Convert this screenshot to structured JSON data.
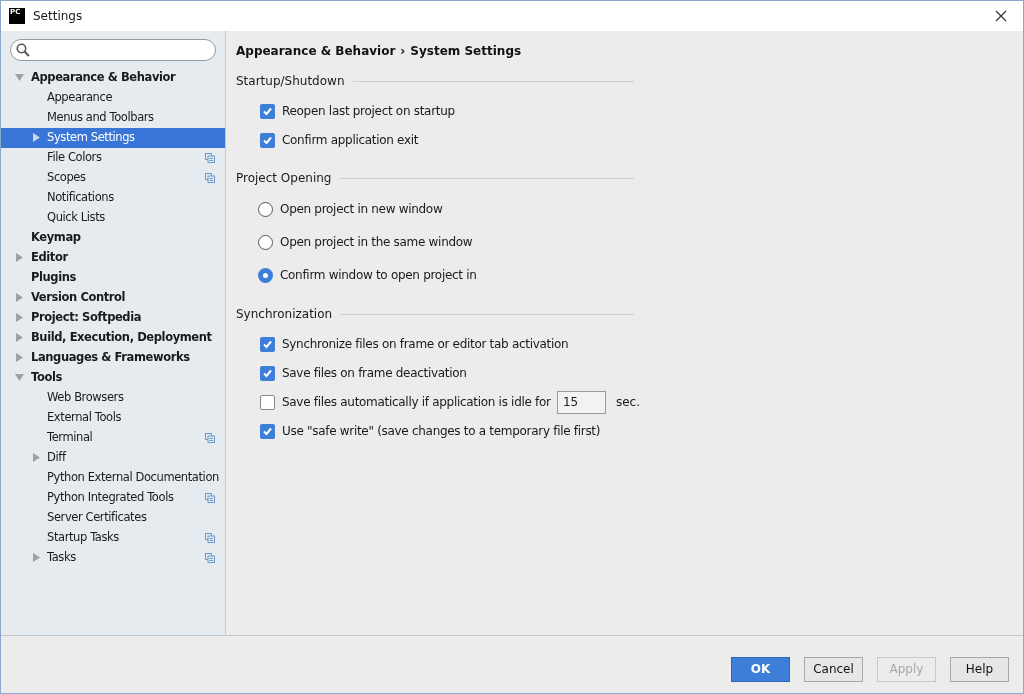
{
  "window": {
    "title": "Settings",
    "app_icon": "PC"
  },
  "tree": [
    {
      "label": "Appearance & Behavior",
      "expanded": true,
      "selected": false,
      "children": [
        {
          "label": "Appearance",
          "selected": false
        },
        {
          "label": "Menus and Toolbars",
          "selected": false
        },
        {
          "label": "System Settings",
          "expanded": false,
          "selected": true
        },
        {
          "label": "File Colors",
          "selected": false,
          "project_level": true
        },
        {
          "label": "Scopes",
          "selected": false,
          "project_level": true
        },
        {
          "label": "Notifications",
          "selected": false
        },
        {
          "label": "Quick Lists",
          "selected": false
        }
      ]
    },
    {
      "label": "Keymap",
      "selected": false
    },
    {
      "label": "Editor",
      "expanded": false,
      "selected": false
    },
    {
      "label": "Plugins",
      "selected": false
    },
    {
      "label": "Version Control",
      "expanded": false,
      "selected": false
    },
    {
      "label": "Project: Softpedia",
      "expanded": false,
      "selected": false
    },
    {
      "label": "Build, Execution, Deployment",
      "expanded": false,
      "selected": false
    },
    {
      "label": "Languages & Frameworks",
      "expanded": false,
      "selected": false
    },
    {
      "label": "Tools",
      "expanded": true,
      "selected": false,
      "children": [
        {
          "label": "Web Browsers",
          "selected": false
        },
        {
          "label": "External Tools",
          "selected": false
        },
        {
          "label": "Terminal",
          "selected": false,
          "project_level": true
        },
        {
          "label": "Diff",
          "expanded": false,
          "selected": false
        },
        {
          "label": "Python External Documentation",
          "selected": false
        },
        {
          "label": "Python Integrated Tools",
          "selected": false,
          "project_level": true
        },
        {
          "label": "Server Certificates",
          "selected": false
        },
        {
          "label": "Startup Tasks",
          "selected": false,
          "project_level": true
        },
        {
          "label": "Tasks",
          "expanded": false,
          "selected": false,
          "project_level": true
        }
      ]
    }
  ],
  "breadcrumb": [
    "Appearance & Behavior",
    "›",
    "System Settings"
  ],
  "sections": [
    {
      "title": "Startup/Shutdown",
      "options": [
        {
          "kind": "checkbox",
          "label": "Reopen last project on startup",
          "checked": true
        },
        {
          "kind": "checkbox",
          "label": "Confirm application exit",
          "checked": true
        }
      ]
    },
    {
      "title": "Project Opening",
      "options": [
        {
          "kind": "radio",
          "label": "Open project in new window",
          "selected": false
        },
        {
          "kind": "radio",
          "label": "Open project in the same window",
          "selected": false
        },
        {
          "kind": "radio",
          "label": "Confirm window to open project in",
          "selected": true
        }
      ]
    },
    {
      "title": "Synchronization",
      "options": [
        {
          "kind": "checkbox",
          "label": "Synchronize files on frame or editor tab activation",
          "checked": true
        },
        {
          "kind": "checkbox",
          "label": "Save files on frame deactivation",
          "checked": true
        },
        {
          "kind": "checkbox",
          "label": "Save files automatically if application is idle for",
          "checked": false,
          "value": "15",
          "unit": "sec."
        },
        {
          "kind": "checkbox",
          "label": "Use \"safe write\" (save changes to a temporary file first)",
          "checked": true
        }
      ]
    }
  ],
  "buttons": [
    {
      "label": "OK",
      "kind": "default",
      "disabled": false
    },
    {
      "label": "Cancel",
      "kind": "normal",
      "disabled": false
    },
    {
      "label": "Apply",
      "kind": "normal",
      "disabled": true
    },
    {
      "label": "Help",
      "kind": "normal",
      "disabled": false
    }
  ]
}
